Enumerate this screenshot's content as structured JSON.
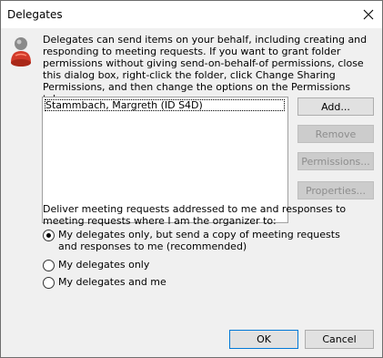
{
  "window": {
    "title": "Delegates"
  },
  "info": {
    "text": "Delegates can send items on your behalf, including creating and responding to meeting requests. If you want to grant folder permissions without giving send-on-behalf-of permissions, close this dialog box, right-click the folder, click Change Sharing Permissions, and then change the options on the Permissions tab."
  },
  "delegates": {
    "items": [
      "Stammbach, Margreth (ID S4D)"
    ]
  },
  "buttons": {
    "add": "Add...",
    "remove": "Remove",
    "permissions": "Permissions...",
    "properties": "Properties...",
    "ok": "OK",
    "cancel": "Cancel"
  },
  "deliver": {
    "label": "Deliver meeting requests addressed to me and responses to meeting requests where I am the organizer to:",
    "options": [
      {
        "label": "My delegates only, but send a copy of meeting requests and responses to me (recommended)",
        "selected": true
      },
      {
        "label": "My delegates only",
        "selected": false
      },
      {
        "label": "My delegates and me",
        "selected": false
      }
    ]
  },
  "colors": {
    "dialog_bg": "#f0f0f0",
    "button_face": "#e1e1e1",
    "focus_border": "#0078d7",
    "disabled_text": "#8d8d8d"
  }
}
